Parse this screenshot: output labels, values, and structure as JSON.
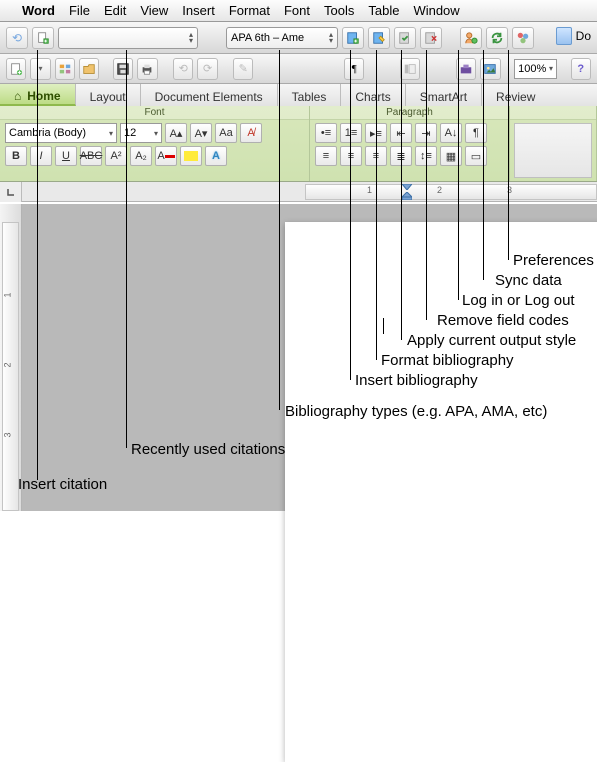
{
  "menubar": {
    "app": "Word",
    "items": [
      "File",
      "Edit",
      "View",
      "Insert",
      "Format",
      "Font",
      "Tools",
      "Table",
      "Window"
    ]
  },
  "citationbar": {
    "style_field": "APA 6th – Ame",
    "doc_label": "Do"
  },
  "stdtoolbar": {
    "zoom": "100%"
  },
  "tabs": [
    "Home",
    "Layout",
    "Document Elements",
    "Tables",
    "Charts",
    "SmartArt",
    "Review"
  ],
  "ribbon": {
    "font_group_label": "Font",
    "para_group_label": "Paragraph",
    "font_name": "Cambria (Body)",
    "font_size": "12"
  },
  "ruler": {
    "n1": "1",
    "n2": "2",
    "n3": "3"
  },
  "annotations": {
    "insert_citation": "Insert citation",
    "recent_citations": "Recently used citations",
    "bib_types": "Bibliography types (e.g. APA, AMA, etc)",
    "insert_bib": "Insert bibliography",
    "format_bib": "Format bibliography",
    "apply_style": "Apply current output style",
    "remove_codes": "Remove field codes",
    "login": "Log in or Log out",
    "sync": "Sync data",
    "prefs": "Preferences"
  }
}
